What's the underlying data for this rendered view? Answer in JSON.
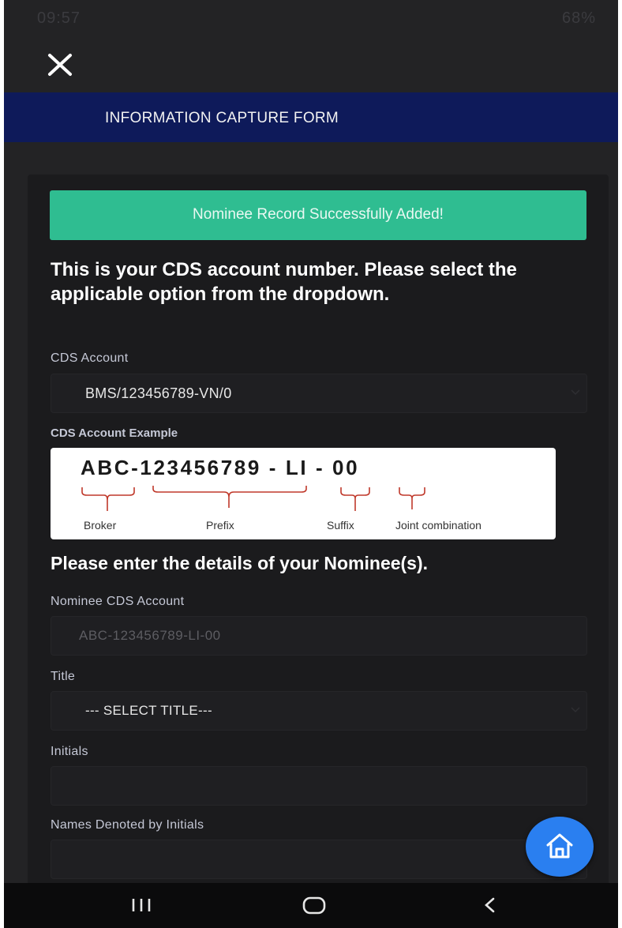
{
  "status_bar": {
    "time": "09:57",
    "battery": "68%"
  },
  "header": {
    "title": "INFORMATION CAPTURE FORM"
  },
  "alert": {
    "message": "Nominee Record Successfully Added!"
  },
  "intro": {
    "text": "This is your CDS account number. Please select the applicable option from the dropdown."
  },
  "cds_account": {
    "label": "CDS Account",
    "value": "BMS/123456789-VN/0"
  },
  "example": {
    "label": "CDS Account Example",
    "code": "ABC-123456789 - LI - 00",
    "parts": [
      "Broker",
      "Prefix",
      "Suffix",
      "Joint combination"
    ]
  },
  "nominee_section": {
    "heading": "Please enter the details of your Nominee(s)."
  },
  "nominee_cds": {
    "label": "Nominee CDS Account",
    "placeholder": "ABC-123456789-LI-00"
  },
  "title_field": {
    "label": "Title",
    "value": "--- SELECT TITLE---"
  },
  "initials": {
    "label": "Initials"
  },
  "names_by_initials": {
    "label": "Names Denoted by Initials"
  },
  "icons": {
    "close": "close-icon",
    "home": "home-icon",
    "chevron": "chevron-down-icon"
  },
  "colors": {
    "header": "#0e1a5a",
    "alert": "#2fbd91",
    "home_button": "#2a7ff0",
    "background": "#232325"
  }
}
